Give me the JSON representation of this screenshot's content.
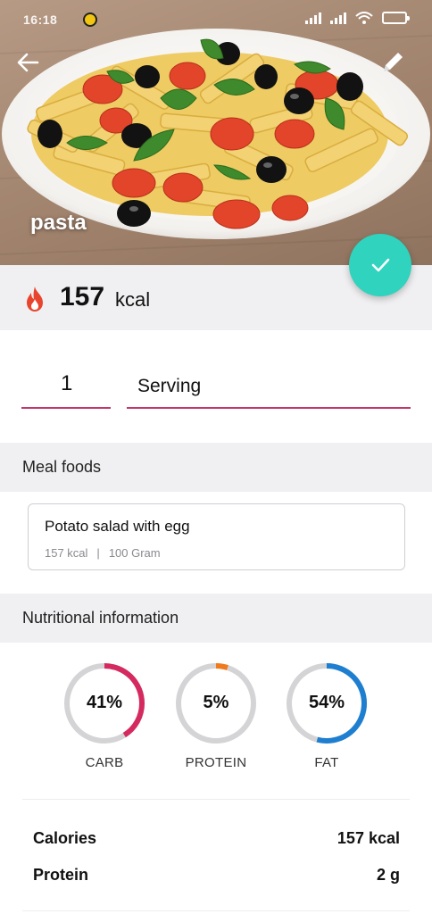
{
  "status_bar": {
    "time": "16:18"
  },
  "hero": {
    "title": "pasta"
  },
  "calories": {
    "value": "157",
    "unit": "kcal"
  },
  "serving": {
    "quantity": "1",
    "unit": "Serving"
  },
  "meal_foods": {
    "header": "Meal foods",
    "items": [
      {
        "name": "Potato salad with egg",
        "kcal": "157 kcal",
        "separator": "|",
        "amount": "100 Gram"
      }
    ]
  },
  "nutrition": {
    "header": "Nutritional information",
    "macros": [
      {
        "percent_text": "41%",
        "percent": 41,
        "label": "CARB",
        "color": "#d42a5f"
      },
      {
        "percent_text": "5%",
        "percent": 5,
        "label": "PROTEIN",
        "color": "#f07b1c"
      },
      {
        "percent_text": "54%",
        "percent": 54,
        "label": "FAT",
        "color": "#1e7fd0"
      }
    ],
    "rows": [
      {
        "label": "Calories",
        "value": "157 kcal"
      },
      {
        "label": "Protein",
        "value": "2 g"
      }
    ]
  },
  "colors": {
    "accent": "#2fd3be",
    "underline": "#c2386a",
    "ring_track": "#d4d4d6"
  },
  "icons": {
    "back": "arrow-left-icon",
    "edit": "pencil-icon",
    "confirm": "check-icon",
    "calories": "flame-icon"
  }
}
